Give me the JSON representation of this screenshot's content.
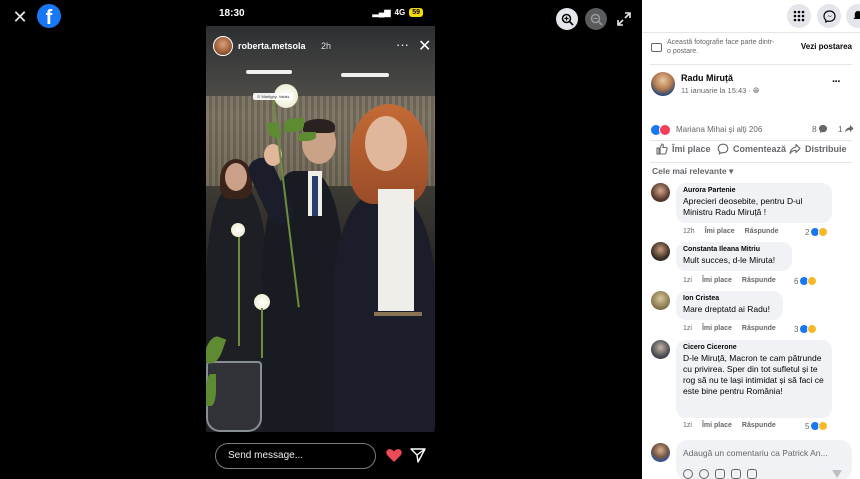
{
  "viewer": {
    "close_glyph": "✕",
    "logo_letter": "f"
  },
  "story": {
    "status_time": "18:30",
    "status_network": "4G",
    "status_battery": "59",
    "username": "roberta.metsola",
    "posted_ago": "2h",
    "more_glyph": "···",
    "close_glyph": "✕",
    "location_sticker": "⊙ Martigny, Valais",
    "message_placeholder": "Send message..."
  },
  "notice": {
    "text": "Această fotografie face parte dintr-o postare.",
    "link": "Vezi postarea"
  },
  "post": {
    "author": "Radu Miruță",
    "date": "11 ianuarie la 15:43 · ",
    "more_glyph": "···",
    "reactions_text": "Mariana Mihai și alți 206",
    "comment_count": "8",
    "share_count": "1"
  },
  "actions": {
    "like": "Îmi place",
    "comment": "Comentează",
    "share": "Distribuie"
  },
  "sort_label": "Cele mai relevante ▾",
  "comments": [
    {
      "name": "Aurora Partenie",
      "text": "Aprecieri deosebite, pentru D-ul Ministru Radu Miruță !",
      "time": "12h",
      "like": "Îmi place",
      "reply": "Răspunde",
      "reactions": "2",
      "avatar_color": "#5a3b30"
    },
    {
      "name": "Constanta Ileana Mitriu",
      "text": "Mult succes, d-le Miruta!",
      "time": "1zi",
      "like": "Îmi place",
      "reply": "Răspunde",
      "reactions": "6",
      "avatar_color": "#3d3027"
    },
    {
      "name": "Ion Cristea",
      "text": "Mare dreptatd ai Radu!",
      "time": "1zi",
      "like": "Îmi place",
      "reply": "Răspunde",
      "reactions": "3",
      "avatar_color": "#8c7d52"
    },
    {
      "name": "Cicero Cicerone",
      "text": "D-le Miruță, Macron te cam pătrunde cu privirea. Sper din tot sufletul și te rog să nu te lași intimidat și să faci ce este bine pentru România!",
      "time": "1zi",
      "like": "Îmi place",
      "reply": "Răspunde",
      "reactions": "5",
      "avatar_color": "#4a4e57"
    }
  ],
  "composer": {
    "placeholder": "Adaugă un comentariu ca Patrick An..."
  },
  "colors": {
    "facebook_blue": "#1877f2",
    "love_red": "#f33e58",
    "heart_red": "#ed4956"
  }
}
